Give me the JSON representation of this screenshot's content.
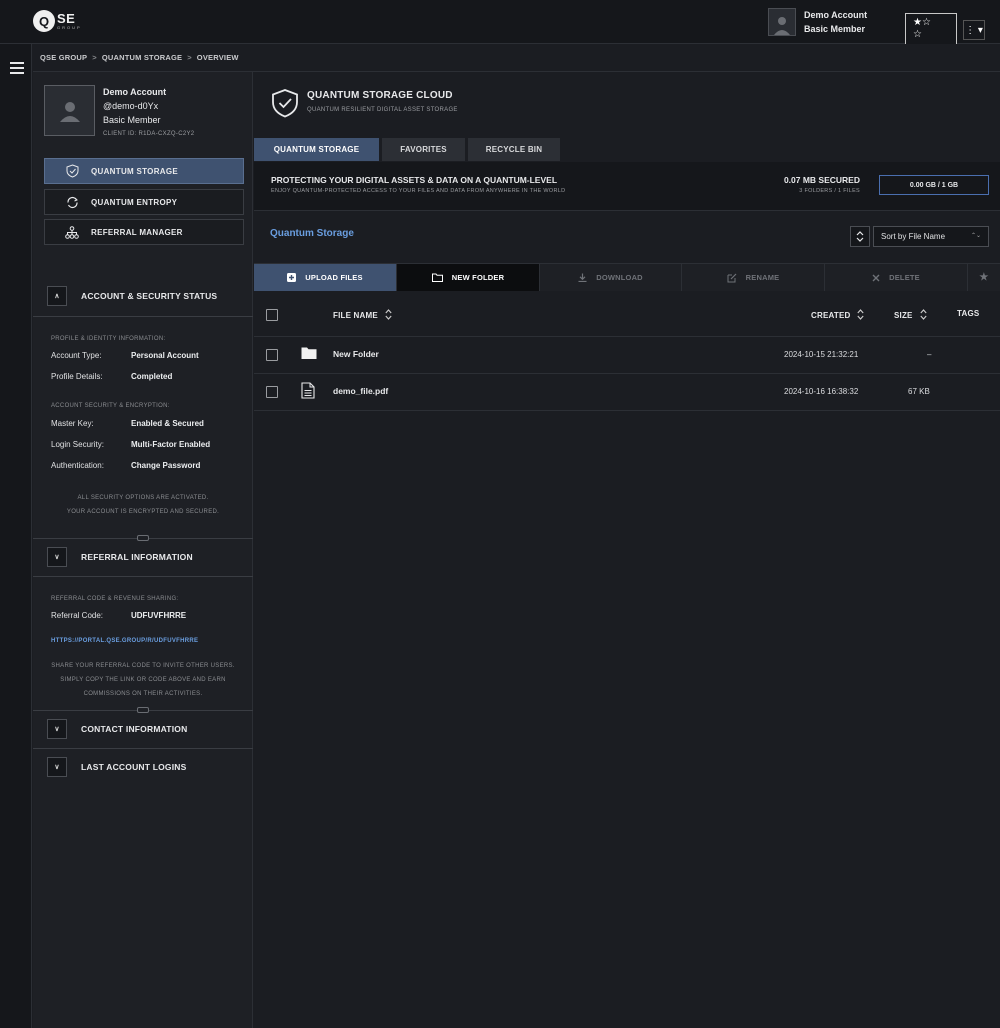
{
  "logo": {
    "letter": "Q",
    "main": "SE",
    "sub": "GROUP"
  },
  "top_user": {
    "name": "Demo Account",
    "tier": "Basic Member"
  },
  "favorites_widget": {
    "line1": "★☆",
    "line2": "☆"
  },
  "menu_button": "⋮ ▾",
  "breadcrumb": [
    "QSE GROUP",
    "QUANTUM STORAGE",
    "OVERVIEW"
  ],
  "breadcrumb_sep": ">",
  "profile": {
    "name": "Demo Account",
    "handle": "@demo-d0Yx",
    "tier": "Basic Member",
    "client_id": "CLIENT ID: R1DA-CXZQ-C2Y2"
  },
  "nav": [
    {
      "label": "QUANTUM STORAGE",
      "icon": "shield-check-icon",
      "active": true
    },
    {
      "label": "QUANTUM ENTROPY",
      "icon": "refresh-icon",
      "active": false
    },
    {
      "label": "REFERRAL MANAGER",
      "icon": "network-icon",
      "active": false
    }
  ],
  "account_security": {
    "title": "ACCOUNT & SECURITY STATUS",
    "chevron": "∧",
    "profile_label": "PROFILE & IDENTITY INFORMATION:",
    "account_type": {
      "k": "Account Type:",
      "v": "Personal Account"
    },
    "profile_details": {
      "k": "Profile Details:",
      "v": "Completed"
    },
    "security_label": "ACCOUNT SECURITY & ENCRYPTION:",
    "master_key": {
      "k": "Master Key:",
      "v": "Enabled & Secured"
    },
    "login_security": {
      "k": "Login Security:",
      "v": "Multi-Factor Enabled"
    },
    "authentication": {
      "k": "Authentication:",
      "v": "Change Password"
    },
    "note1": "ALL SECURITY OPTIONS ARE ACTIVATED.",
    "note2": "YOUR ACCOUNT IS ENCRYPTED AND SECURED."
  },
  "referral": {
    "title": "REFERRAL INFORMATION",
    "chevron": "∨",
    "label": "REFERRAL CODE & REVENUE SHARING:",
    "code": {
      "k": "Referral Code:",
      "v": "UDFUVFHRRE"
    },
    "link": "HTTPS://PORTAL.QSE.GROUP/R/UDFUVFHRRE",
    "note1": "SHARE YOUR REFERRAL CODE TO INVITE OTHER USERS.",
    "note2": "SIMPLY COPY THE LINK OR CODE ABOVE AND EARN",
    "note3": "COMMISSIONS ON THEIR ACTIVITIES."
  },
  "contact": {
    "title": "CONTACT INFORMATION",
    "chevron": "∨"
  },
  "logins": {
    "title": "LAST ACCOUNT LOGINS",
    "chevron": "∨"
  },
  "header": {
    "title": "QUANTUM STORAGE CLOUD",
    "subtitle": "QUANTUM RESILIENT DIGITAL ASSET STORAGE"
  },
  "tabs": [
    "QUANTUM STORAGE",
    "FAVORITES",
    "RECYCLE BIN"
  ],
  "banner": {
    "title": "PROTECTING YOUR DIGITAL ASSETS & DATA ON A QUANTUM-LEVEL",
    "subtitle": "ENJOY QUANTUM-PROTECTED ACCESS TO YOUR FILES AND DATA FROM ANYWHERE IN THE WORLD",
    "secured": "0.07 MB SECURED",
    "counts": "3 FOLDERS / 1 FILES",
    "quota": "0.00 GB / 1 GB"
  },
  "section_title": "Quantum Storage",
  "sort": {
    "value": "Sort by File Name",
    "caret": "⌃⌄"
  },
  "toolbar": {
    "upload": "UPLOAD FILES",
    "new_folder": "NEW FOLDER",
    "download": "DOWNLOAD",
    "rename": "RENAME",
    "delete": "DELETE",
    "star": "★"
  },
  "table": {
    "col_name": "FILE NAME",
    "col_created": "CREATED",
    "col_size": "SIZE",
    "col_tags": "TAGS",
    "rows": [
      {
        "name": "New Folder",
        "type": "folder",
        "created": "2024-10-15 21:32:21",
        "size": "–"
      },
      {
        "name": "demo_file.pdf",
        "type": "file",
        "created": "2024-10-16 16:38:32",
        "size": "67 KB"
      }
    ]
  }
}
